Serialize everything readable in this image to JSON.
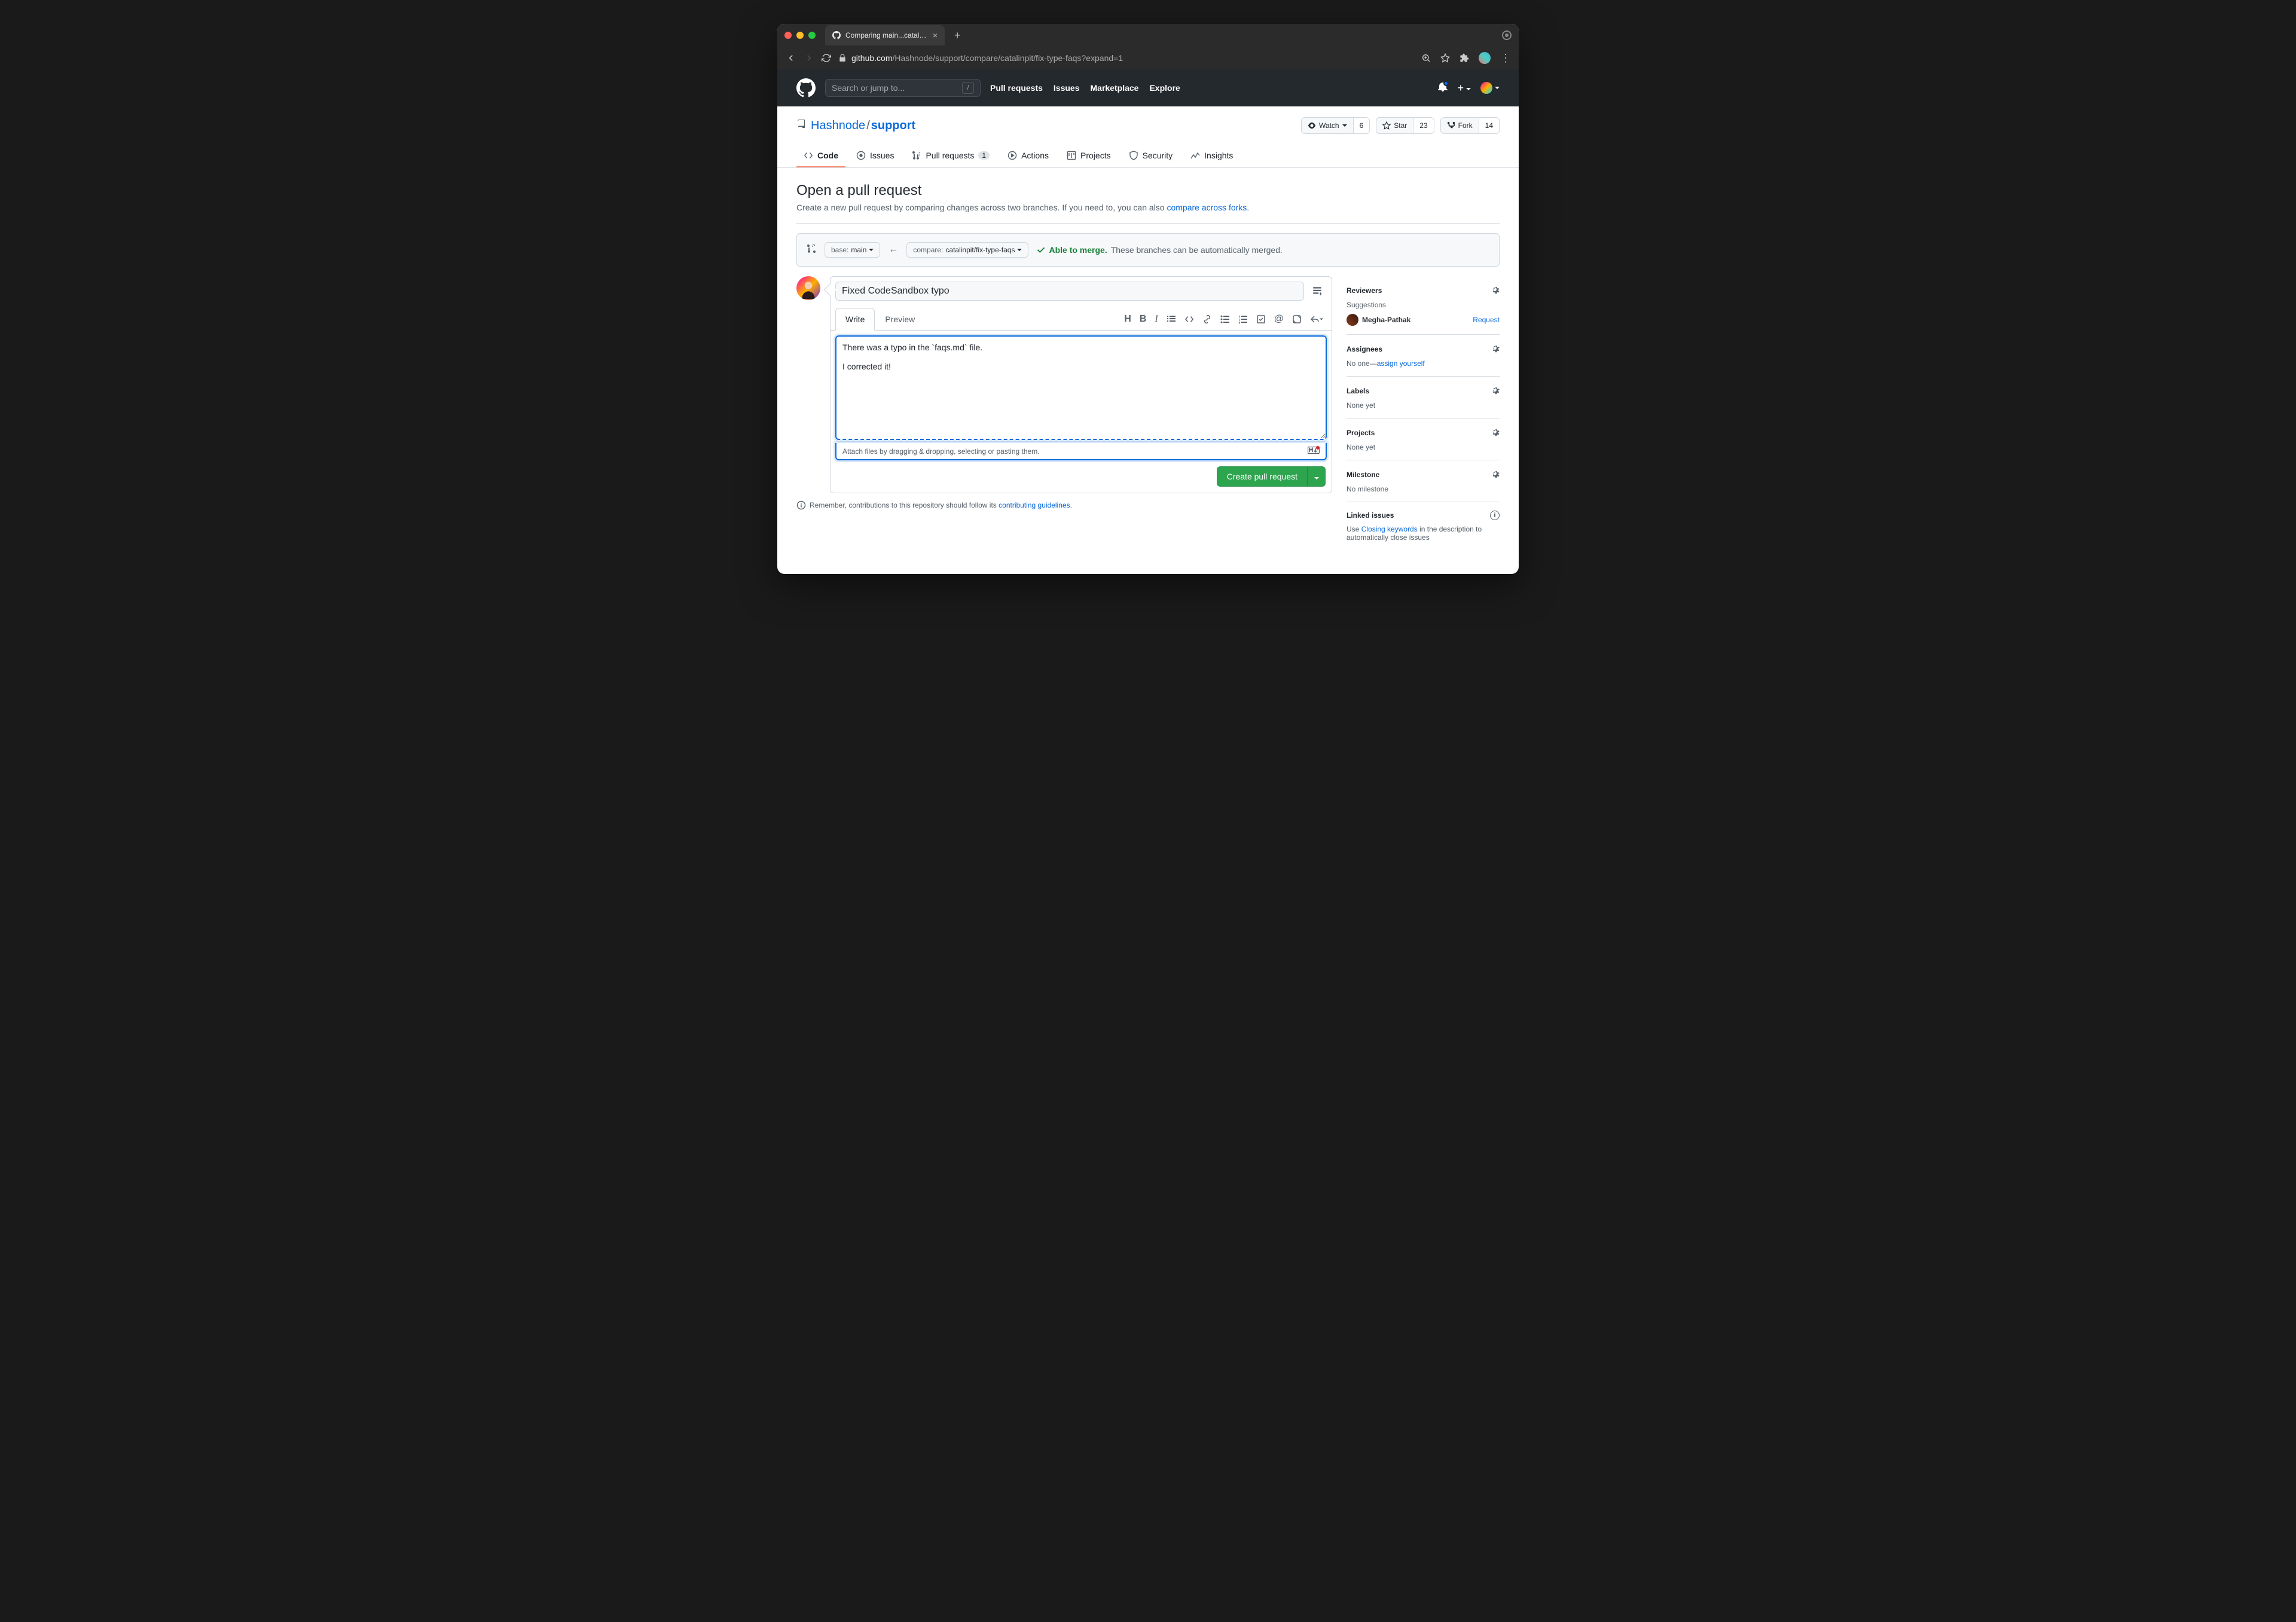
{
  "browser": {
    "tab_title": "Comparing main...catalinpit/fix",
    "url_host": "github.com",
    "url_path": "/Hashnode/support/compare/catalinpit/fix-type-faqs?expand=1"
  },
  "gh": {
    "search_placeholder": "Search or jump to...",
    "nav": [
      "Pull requests",
      "Issues",
      "Marketplace",
      "Explore"
    ]
  },
  "repo": {
    "owner": "Hashnode",
    "name": "support",
    "watch_label": "Watch",
    "watch_count": "6",
    "star_label": "Star",
    "star_count": "23",
    "fork_label": "Fork",
    "fork_count": "14",
    "tabs": {
      "code": "Code",
      "issues": "Issues",
      "pulls": "Pull requests",
      "pulls_count": "1",
      "actions": "Actions",
      "projects": "Projects",
      "security": "Security",
      "insights": "Insights"
    }
  },
  "page": {
    "title": "Open a pull request",
    "sub_pre": "Create a new pull request by comparing changes across two branches. If you need to, you can also ",
    "sub_link": "compare across forks",
    "base_label": "base: ",
    "base_value": "main",
    "compare_label": "compare: ",
    "compare_value": "catalinpit/fix-type-faqs",
    "merge_ok": "Able to merge.",
    "merge_rest": "These branches can be automatically merged."
  },
  "composer": {
    "title_value": "Fixed CodeSandbox typo",
    "write_tab": "Write",
    "preview_tab": "Preview",
    "body_value": "There was a typo in the `faqs.md` file.\n\nI corrected it!",
    "attach_text": "Attach files by dragging & dropping, selecting or pasting them.",
    "submit_label": "Create pull request"
  },
  "contrib_note": {
    "pre": "Remember, contributions to this repository should follow its ",
    "link": "contributing guidelines"
  },
  "sidebar": {
    "reviewers": {
      "head": "Reviewers",
      "sub": "Suggestions",
      "name": "Megha-Pathak",
      "request": "Request"
    },
    "assignees": {
      "head": "Assignees",
      "text_pre": "No one—",
      "text_link": "assign yourself"
    },
    "labels": {
      "head": "Labels",
      "text": "None yet"
    },
    "projects": {
      "head": "Projects",
      "text": "None yet"
    },
    "milestone": {
      "head": "Milestone",
      "text": "No milestone"
    },
    "linked": {
      "head": "Linked issues",
      "pre": "Use ",
      "link": "Closing keywords",
      "post": " in the description to automatically close issues"
    }
  }
}
